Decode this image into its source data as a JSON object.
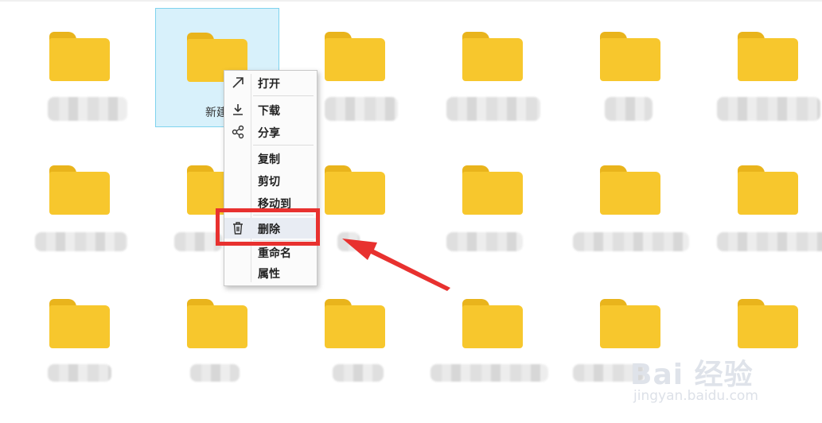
{
  "selected_folder": {
    "name": "新建文"
  },
  "context_menu": {
    "items": [
      {
        "label": "打开",
        "icon": "open-arrow-icon"
      },
      {
        "label": "下载",
        "icon": "download-icon"
      },
      {
        "label": "分享",
        "icon": "share-icon"
      },
      {
        "label": "复制"
      },
      {
        "label": "剪切"
      },
      {
        "label": "移动到"
      },
      {
        "label": "删除",
        "icon": "trash-icon",
        "highlighted": true
      },
      {
        "label": "重命名"
      },
      {
        "label": "属性"
      }
    ]
  },
  "colors": {
    "folder": "#f7c72d",
    "folder_tab": "#e9b41c",
    "selection": "#d8f1fb",
    "annotation": "#e8312f"
  },
  "watermark": {
    "main": "Bai 经验",
    "sub": "jingyan.baidu.com"
  }
}
